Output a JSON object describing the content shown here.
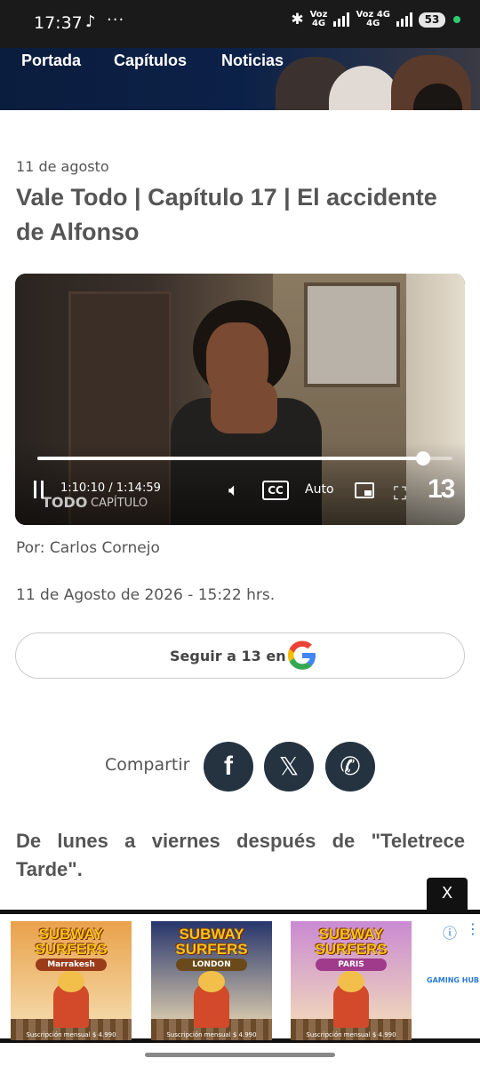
{
  "status_bar": {
    "time": "17:37",
    "tiktok_glyph": "♪",
    "more": "···",
    "net1_top": "Voz",
    "net1_bottom": "4G",
    "net2_top": "Voz 4G",
    "net2_bottom": "4G",
    "battery": "53"
  },
  "nav": {
    "items": [
      "Portada",
      "Capítulos",
      "Noticias"
    ]
  },
  "article": {
    "date_short": "11 de agosto",
    "title": "Vale Todo | Capítulo 17 | El accidente de Alfonso",
    "author": "Por: Carlos Cornejo",
    "published": "11 de Agosto de 2026 - 15:22 hrs.",
    "lead": "De lunes a viernes después de \"Teletrece Tarde\"."
  },
  "player": {
    "time": "1:10:10 / 1:14:59",
    "progress": 0.93,
    "cc_label": "CC",
    "quality": "Auto",
    "watermark_logo": "TODO",
    "watermark_text": "CAPÍTULO",
    "channel_logo": "13"
  },
  "follow": {
    "label": "Seguir a 13 en"
  },
  "share": {
    "label": "Compartir",
    "facebook_glyph": "f",
    "x_glyph": "𝕏",
    "whatsapp_glyph": "✆"
  },
  "ad": {
    "close": "X",
    "info_glyph": "ⓘ",
    "more_glyph": "⋮",
    "brand": "GAMING HUB",
    "cards": [
      {
        "title": "SUBWAY SURFERS",
        "subtitle": "Marrakesh",
        "price": "Suscripción mensual $ 4.990",
        "sky": "#e9a14a",
        "sub_color": "#9a3b1a"
      },
      {
        "title": "SUBWAY SURFERS",
        "subtitle": "LONDON",
        "price": "Suscripción mensual $ 4.990",
        "sky": "#26356b",
        "sub_color": "#6a4a1a"
      },
      {
        "title": "SUBWAY SURFERS",
        "subtitle": "PARIS",
        "price": "Suscripción mensual $ 4.990",
        "sky": "#c98ad2",
        "sub_color": "#a03a8a"
      }
    ]
  }
}
